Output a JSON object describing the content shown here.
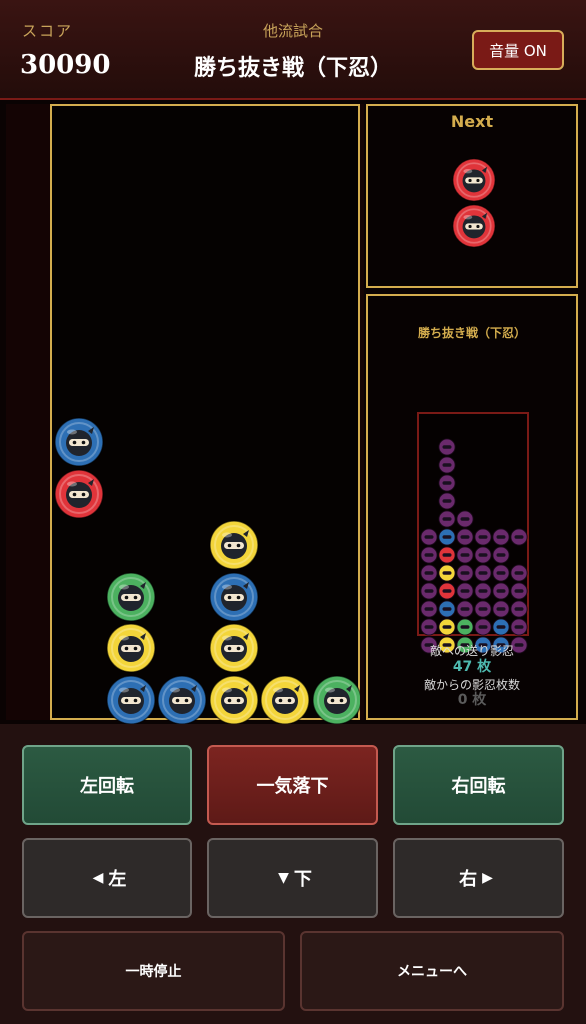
{
  "header": {
    "score_label": "スコア",
    "score_value": "30090",
    "mode_label": "他流試合",
    "stage_title": "勝ち抜き戦（下忍）",
    "sound_button": "音量 ON"
  },
  "next": {
    "title": "Next",
    "pieces": [
      "red",
      "red"
    ]
  },
  "board": {
    "columns": 6,
    "rows": 12,
    "cells": [
      {
        "col": 0,
        "row": 6,
        "color": "blue"
      },
      {
        "col": 0,
        "row": 7,
        "color": "red"
      },
      {
        "col": 3,
        "row": 8,
        "color": "yellow"
      },
      {
        "col": 1,
        "row": 9,
        "color": "green"
      },
      {
        "col": 3,
        "row": 9,
        "color": "blue"
      },
      {
        "col": 1,
        "row": 10,
        "color": "yellow"
      },
      {
        "col": 3,
        "row": 10,
        "color": "yellow"
      },
      {
        "col": 1,
        "row": 11,
        "color": "blue"
      },
      {
        "col": 2,
        "row": 11,
        "color": "blue"
      },
      {
        "col": 3,
        "row": 11,
        "color": "yellow"
      },
      {
        "col": 4,
        "row": 11,
        "color": "yellow"
      },
      {
        "col": 5,
        "row": 11,
        "color": "green"
      }
    ]
  },
  "opponent": {
    "title": "勝ち抜き戦（下忍）",
    "sent_label": "敵への送り影忍",
    "sent_value": "47 枚",
    "received_label": "敵からの影忍枚数",
    "received_value": "0 枚",
    "grid": [
      "......",
      "......",
      ".P....",
      ".P....",
      ".P....",
      ".P....",
      ".PP...",
      "PBPPPP",
      "PRPPP.",
      "PYPPPP",
      "PRPPPP",
      "PBPPPP",
      "PYGPBP",
      "PYGBBP"
    ]
  },
  "controls": {
    "rotate_left": "左回転",
    "hard_drop": "一気落下",
    "rotate_right": "右回転",
    "move_left": "左",
    "move_down": "下",
    "move_right": "右",
    "pause": "一時停止",
    "menu": "メニューへ"
  },
  "colors": {
    "red": "#e0343a",
    "blue": "#2d6fb4",
    "yellow": "#f3d53a",
    "green": "#4cb160",
    "purple": "#6a2a6c",
    "gold": "#d4ad4e"
  }
}
